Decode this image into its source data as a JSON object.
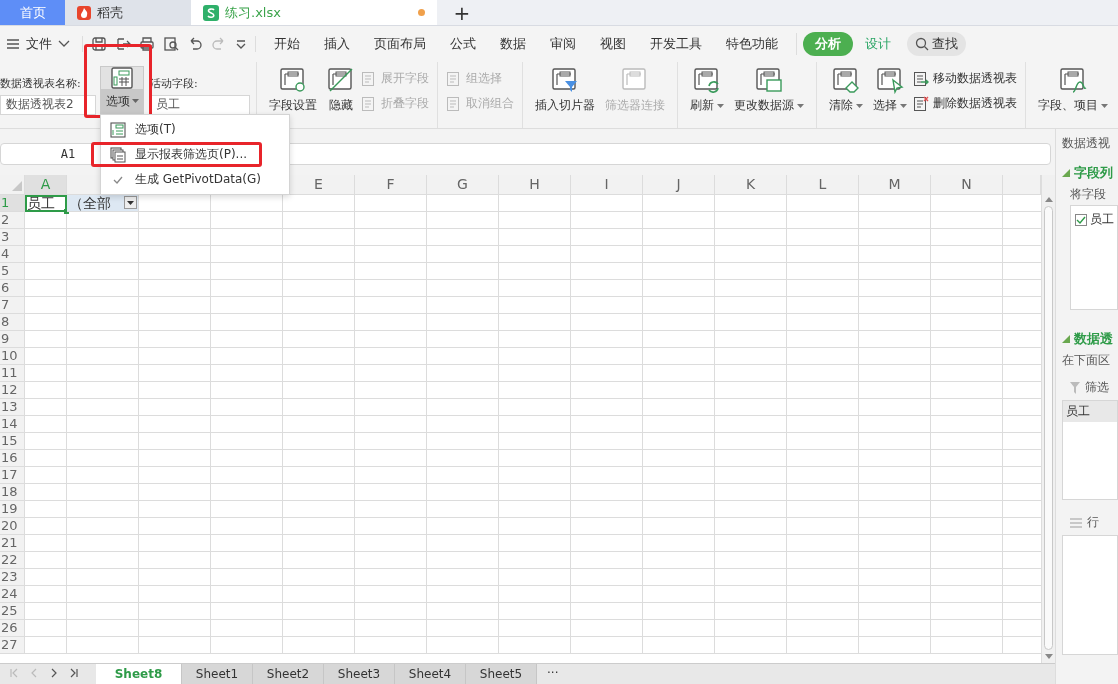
{
  "tabs": [
    {
      "label": "首页",
      "kind": "home",
      "selected": false,
      "modified": false
    },
    {
      "label": "稻壳",
      "kind": "docer",
      "selected": false,
      "modified": false
    },
    {
      "label": "练习.xlsx",
      "kind": "sheet",
      "selected": true,
      "modified": true
    }
  ],
  "new_tab": "+",
  "file_menu": "文件",
  "menu_tabs": [
    {
      "label": "开始",
      "kind": "main",
      "selected": false
    },
    {
      "label": "插入",
      "kind": "main",
      "selected": false
    },
    {
      "label": "页面布局",
      "kind": "main",
      "selected": false
    },
    {
      "label": "公式",
      "kind": "main",
      "selected": false
    },
    {
      "label": "数据",
      "kind": "main",
      "selected": false
    },
    {
      "label": "审阅",
      "kind": "main",
      "selected": false
    },
    {
      "label": "视图",
      "kind": "main",
      "selected": false
    },
    {
      "label": "开发工具",
      "kind": "main",
      "selected": false
    },
    {
      "label": "特色功能",
      "kind": "main",
      "selected": false
    },
    {
      "label": "分析",
      "kind": "context",
      "selected": true
    },
    {
      "label": "设计",
      "kind": "context",
      "selected": false
    }
  ],
  "search": "查找",
  "ribbon": {
    "pivot_name_label": "数据透视表名称:",
    "pivot_name_value": "数据透视表2",
    "options_button": {
      "label": "选项",
      "open": true,
      "highlighted": true
    },
    "active_field_label": "活动字段:",
    "active_field_value": "员工",
    "groups": [
      {
        "items": [
          {
            "label": "字段设置",
            "kind": "large",
            "disabled": false,
            "dropdown": false
          },
          {
            "label": "隐藏",
            "kind": "large",
            "disabled": false,
            "dropdown": false
          },
          {
            "label": "展开字段",
            "kind": "small",
            "disabled": true,
            "dropdown": false
          },
          {
            "label": "折叠字段",
            "kind": "small",
            "disabled": true,
            "dropdown": false
          }
        ]
      },
      {
        "items": [
          {
            "label": "组选择",
            "kind": "small",
            "disabled": true,
            "dropdown": false
          },
          {
            "label": "取消组合",
            "kind": "small",
            "disabled": true,
            "dropdown": false
          }
        ]
      },
      {
        "items": [
          {
            "label": "插入切片器",
            "kind": "large",
            "disabled": false,
            "dropdown": false
          },
          {
            "label": "筛选器连接",
            "kind": "large",
            "disabled": true,
            "dropdown": false
          }
        ]
      },
      {
        "items": [
          {
            "label": "刷新",
            "kind": "large",
            "disabled": false,
            "dropdown": true
          },
          {
            "label": "更改数据源",
            "kind": "large",
            "disabled": false,
            "dropdown": true
          }
        ]
      },
      {
        "items": [
          {
            "label": "清除",
            "kind": "large",
            "disabled": false,
            "dropdown": true
          },
          {
            "label": "选择",
            "kind": "large",
            "disabled": false,
            "dropdown": true
          },
          {
            "label": "移动数据透视表",
            "kind": "small",
            "disabled": false,
            "dropdown": false
          },
          {
            "label": "删除数据透视表",
            "kind": "small",
            "disabled": false,
            "dropdown": false
          }
        ]
      },
      {
        "items": [
          {
            "label": "字段、项目",
            "kind": "large",
            "disabled": false,
            "dropdown": true
          }
        ]
      }
    ]
  },
  "options_menu": [
    {
      "label": "选项(T)",
      "kind": "options",
      "highlighted": false
    },
    {
      "label": "显示报表筛选页(P)...",
      "kind": "pages",
      "highlighted": true
    },
    {
      "label": "生成 GetPivotData(G)",
      "kind": "toggle",
      "checked": true,
      "highlighted": false
    }
  ],
  "name_box": "A1",
  "columns": [
    {
      "label": "A",
      "selected": true
    },
    {
      "label": "E",
      "selected": false
    },
    {
      "label": "F",
      "selected": false
    },
    {
      "label": "G",
      "selected": false
    },
    {
      "label": "H",
      "selected": false
    },
    {
      "label": "I",
      "selected": false
    },
    {
      "label": "J",
      "selected": false
    },
    {
      "label": "K",
      "selected": false
    },
    {
      "label": "L",
      "selected": false
    },
    {
      "label": "M",
      "selected": false
    },
    {
      "label": "N",
      "selected": false
    }
  ],
  "rows": [
    {
      "label": "1",
      "selected": true,
      "cells": [
        {
          "text": "员工",
          "selected": true,
          "filter_button": false
        },
        {
          "text": "（全部",
          "selected": false,
          "filter_button": true
        }
      ]
    },
    {
      "label": "2",
      "selected": false
    },
    {
      "label": "3",
      "selected": false
    },
    {
      "label": "4",
      "selected": false
    },
    {
      "label": "5",
      "selected": false
    },
    {
      "label": "6",
      "selected": false
    },
    {
      "label": "7",
      "selected": false
    },
    {
      "label": "8",
      "selected": false
    },
    {
      "label": "9",
      "selected": false
    },
    {
      "label": "10",
      "selected": false
    },
    {
      "label": "11",
      "selected": false
    },
    {
      "label": "12",
      "selected": false
    },
    {
      "label": "13",
      "selected": false
    },
    {
      "label": "14",
      "selected": false
    },
    {
      "label": "15",
      "selected": false
    },
    {
      "label": "16",
      "selected": false
    },
    {
      "label": "17",
      "selected": false
    },
    {
      "label": "18",
      "selected": false
    },
    {
      "label": "19",
      "selected": false
    },
    {
      "label": "20",
      "selected": false
    },
    {
      "label": "21",
      "selected": false
    },
    {
      "label": "22",
      "selected": false
    },
    {
      "label": "23",
      "selected": false
    },
    {
      "label": "24",
      "selected": false
    },
    {
      "label": "25",
      "selected": false
    },
    {
      "label": "26",
      "selected": false
    },
    {
      "label": "27",
      "selected": false
    }
  ],
  "sheet_tabs": [
    {
      "label": "Sheet8",
      "selected": true
    },
    {
      "label": "Sheet1",
      "selected": false
    },
    {
      "label": "Sheet2",
      "selected": false
    },
    {
      "label": "Sheet3",
      "selected": false
    },
    {
      "label": "Sheet4",
      "selected": false
    },
    {
      "label": "Sheet5",
      "selected": false
    }
  ],
  "more_sheets": "···",
  "panel": {
    "title": "数据透视",
    "field_section": "字段列",
    "field_hint": "将字段",
    "fields": [
      {
        "label": "员工",
        "checked": true
      }
    ],
    "area_section": "数据透",
    "area_hint": "在下面区",
    "filter_label": "筛选",
    "filter_items": [
      "员工"
    ],
    "rows_label": "行"
  }
}
